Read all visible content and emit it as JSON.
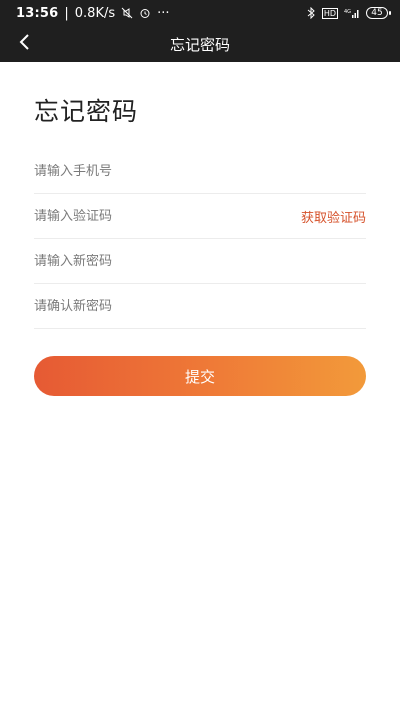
{
  "status_bar": {
    "time": "13:56",
    "network_speed": "0.8K/s",
    "more": "···",
    "battery": "45",
    "icons": [
      "mute-icon",
      "alarm-icon",
      "bluetooth-icon",
      "hd-icon",
      "signal-icon",
      "battery-icon"
    ],
    "network_label": "HD",
    "signal_label": "4G"
  },
  "nav": {
    "title": "忘记密码",
    "back_icon": "chevron-left-icon"
  },
  "page": {
    "title": "忘记密码"
  },
  "form": {
    "phone_placeholder": "请输入手机号",
    "code_placeholder": "请输入验证码",
    "get_code_label": "获取验证码",
    "new_password_placeholder": "请输入新密码",
    "confirm_password_placeholder": "请确认新密码",
    "submit_label": "提交"
  },
  "colors": {
    "bar_bg": "#1f1f1f",
    "accent": "#d6522b",
    "button_start": "#e65a34",
    "button_end": "#f29a3a"
  }
}
